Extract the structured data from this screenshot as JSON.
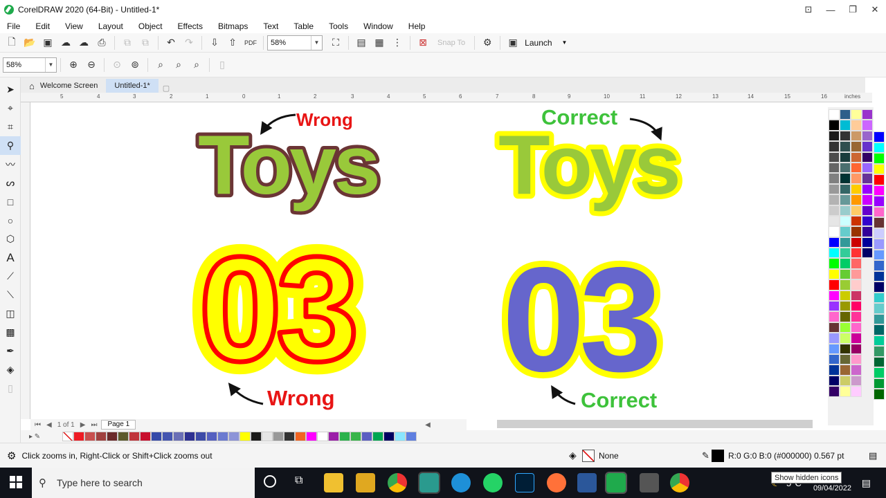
{
  "window": {
    "title": "CorelDRAW 2020 (64-Bit) - Untitled-1*"
  },
  "menu": [
    "File",
    "Edit",
    "View",
    "Layout",
    "Object",
    "Effects",
    "Bitmaps",
    "Text",
    "Table",
    "Tools",
    "Window",
    "Help"
  ],
  "toolbar": {
    "zoom": "58%",
    "snap_to": "Snap To",
    "launch": "Launch"
  },
  "propertybar": {
    "zoom": "58%"
  },
  "tabs": [
    {
      "label": "Welcome Screen"
    },
    {
      "label": "Untitled-1*"
    }
  ],
  "ruler": {
    "ticks": [
      "5",
      "4",
      "3",
      "2",
      "1",
      "0",
      "1",
      "2",
      "3",
      "4",
      "5",
      "6",
      "7",
      "8",
      "9",
      "10",
      "11",
      "12",
      "13",
      "14",
      "15",
      "16"
    ],
    "unit": "inches"
  },
  "canvas": {
    "top_left": {
      "label": "Wrong",
      "word": "Toys"
    },
    "top_right": {
      "label": "Correct",
      "word": "Toys"
    },
    "bottom_left": {
      "label": "Wrong",
      "word": "03"
    },
    "bottom_right": {
      "label": "Correct",
      "word": "03"
    }
  },
  "colors": {
    "wrong": "#e81515",
    "correct": "#3ec23b",
    "toys_fill": "#99c93a",
    "toys_outline_wrong": "#6b3535",
    "yellow": "#ffff00",
    "red": "#ff0000",
    "purple": "#6666cc"
  },
  "pagenav": {
    "counter": "1 of 1",
    "page": "Page 1"
  },
  "status": {
    "hint": "Click zooms in, Right-Click or Shift+Click zooms out",
    "fill": "None",
    "outline": "R:0 G:0 B:0 (#000000)  0.567 pt"
  },
  "taskbar": {
    "search_placeholder": "Type here to search",
    "temperature": "5°C",
    "tooltip": "Show hidden icons",
    "date": "09/04/2022"
  },
  "palette_colors": [
    "#ffffff",
    "#ee1c24",
    "#c8504f",
    "#a0413f",
    "#6b2b2b",
    "#5d5b2d",
    "#c0353b",
    "#c8102e",
    "#3549a9",
    "#4455b0",
    "#6a6fb6",
    "#2e3192",
    "#3d4ba8",
    "#5560c0",
    "#6b7ad0",
    "#8d94d8",
    "#ffff00",
    "#1a1a1a",
    "#e6e6e6",
    "#999999",
    "#333333",
    "#f26522",
    "#ff00ff",
    "#ffffff",
    "#9b1fa8",
    "#2bb24c",
    "#39b54a",
    "#5b5ec2",
    "#00a651",
    "#000060",
    "#8ae6ff",
    "#5f7fe0"
  ]
}
